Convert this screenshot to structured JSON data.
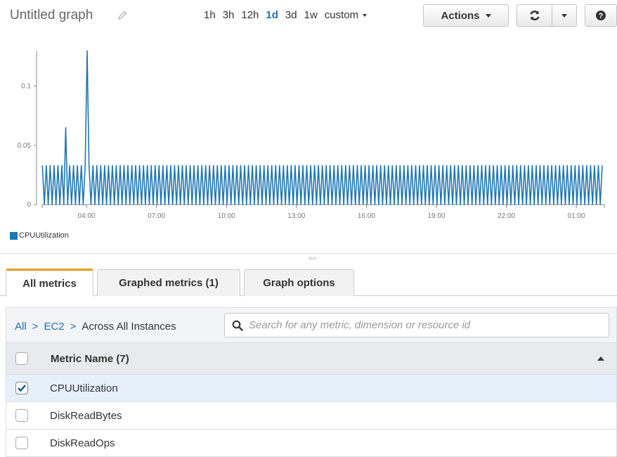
{
  "header": {
    "title": "Untitled graph",
    "ranges": [
      "1h",
      "3h",
      "12h",
      "1d",
      "3d",
      "1w"
    ],
    "active_range": "1d",
    "custom_label": "custom",
    "actions_label": "Actions"
  },
  "chart_data": {
    "type": "line",
    "series": [
      {
        "name": "CPUUtilization",
        "color": "#1f77b4"
      }
    ],
    "y_ticks": [
      "0",
      "0.05",
      "0.1"
    ],
    "ylim": [
      0,
      0.13
    ],
    "x_ticks": [
      "04:00",
      "07:00",
      "10:00",
      "13:00",
      "16:00",
      "19:00",
      "22:00",
      "01:00"
    ],
    "xlim_hours": [
      2.1,
      26.2
    ],
    "pattern": {
      "high": 0.033,
      "low": 0.0,
      "period_minutes": 10
    },
    "spikes": [
      {
        "time": "03:05",
        "value": 0.065
      },
      {
        "time": "04:00",
        "value": 0.13
      }
    ]
  },
  "legend": {
    "label": "CPUUtilization",
    "color": "#1f77b4"
  },
  "tabs": [
    "All metrics",
    "Graphed metrics (1)",
    "Graph options"
  ],
  "breadcrumb": {
    "all": "All",
    "ec2": "EC2",
    "current": "Across All Instances"
  },
  "search": {
    "placeholder": "Search for any metric, dimension or resource id"
  },
  "table": {
    "header": "Metric Name (7)",
    "rows": [
      {
        "name": "CPUUtilization",
        "checked": true
      },
      {
        "name": "DiskReadBytes",
        "checked": false
      },
      {
        "name": "DiskReadOps",
        "checked": false
      }
    ]
  }
}
